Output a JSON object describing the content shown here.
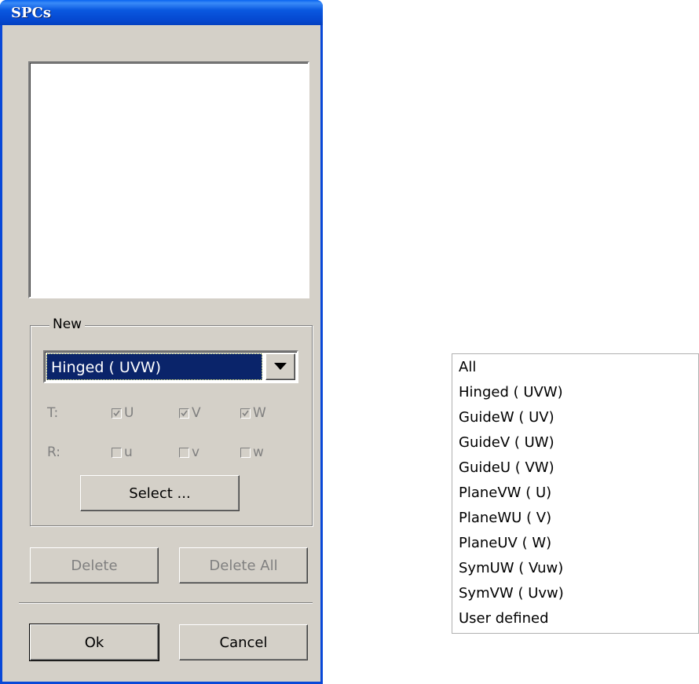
{
  "window": {
    "title": "SPCs"
  },
  "group": {
    "label": "New",
    "combo_value": "Hinged ( UVW)",
    "translation_label": "T:",
    "rotation_label": "R:",
    "translation_checks": [
      {
        "label": "U",
        "checked": true
      },
      {
        "label": "V",
        "checked": true
      },
      {
        "label": "W",
        "checked": true
      }
    ],
    "rotation_checks": [
      {
        "label": "u",
        "checked": false
      },
      {
        "label": "v",
        "checked": false
      },
      {
        "label": "w",
        "checked": false
      }
    ],
    "select_button": "Select ..."
  },
  "buttons": {
    "delete": "Delete",
    "delete_all": "Delete All",
    "ok": "Ok",
    "cancel": "Cancel"
  },
  "dropdown_options": [
    "All",
    "Hinged ( UVW)",
    "GuideW ( UV)",
    "GuideV ( UW)",
    "GuideU ( VW)",
    "PlaneVW ( U)",
    "PlaneWU ( V)",
    "PlaneUV ( W)",
    "SymUW ( Vuw)",
    "SymVW ( Uvw)",
    "User defined"
  ]
}
